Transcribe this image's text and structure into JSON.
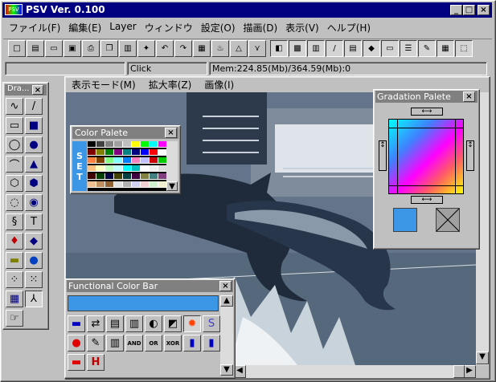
{
  "app": {
    "title": "PSV Ver. 0.100"
  },
  "menu": [
    "ファイル(F)",
    "編集(E)",
    "Layer",
    "ウィンドウ",
    "設定(O)",
    "描画(D)",
    "表示(V)",
    "ヘルプ(H)"
  ],
  "status": {
    "mode": "Click",
    "memory": "Mem:224.85(Mb)/364.59(Mb):0"
  },
  "doc_menu": [
    "表示モード(M)",
    "拡大率(Z)",
    "画像(I)"
  ],
  "tools_panel": {
    "title": "Dra..."
  },
  "color_palette": {
    "title": "Color Palete",
    "set_label": "SET"
  },
  "gradation": {
    "title": "Gradation Palete"
  },
  "functional_bar": {
    "title": "Functional Color Bar",
    "current_color": "#3c96e6",
    "buttons": [
      "AND",
      "OR",
      "XOR"
    ]
  },
  "icons": [
    "new-icon",
    "open-icon",
    "scan-icon",
    "save-icon",
    "print-icon",
    "copy-icon",
    "paste-icon",
    "stamp-icon",
    "undo-icon",
    "redo-icon",
    "new-layer-icon",
    "flask-icon",
    "triangle-icon",
    "vector-icon",
    "layer-icon",
    "palette-icon",
    "gradient-icon",
    "brush-icon",
    "layers-icon",
    "shapes-icon",
    "screen-icon",
    "list-icon",
    "pen-icon",
    "grid-icon",
    "select-icon"
  ],
  "accent": {
    "title_bar": "#000080",
    "selected_fill": "#3c96e6"
  }
}
